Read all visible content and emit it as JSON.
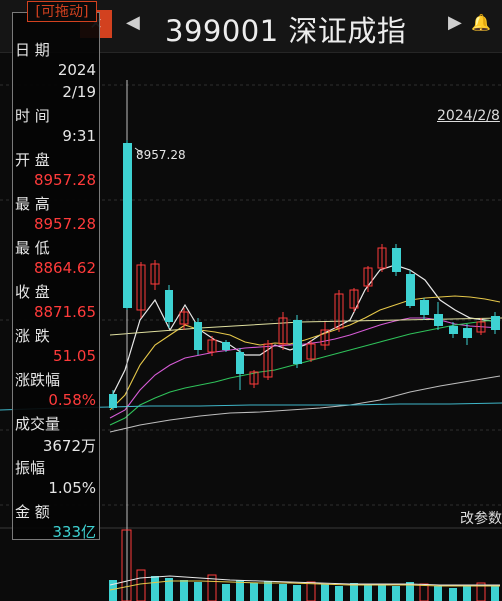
{
  "header": {
    "close_label": "✕",
    "title": "399001 深证成指"
  },
  "chart": {
    "date_label": "2024/2/8",
    "params_label": "改参数",
    "high_marker": "8957.28"
  },
  "panel": {
    "drag_label": "[可拖动]",
    "rows": [
      {
        "label": "日    期",
        "value": "2024"
      },
      {
        "label": "",
        "value": "2/19"
      },
      {
        "label": "时    间",
        "value": "9:31"
      },
      {
        "label": "开    盘",
        "value": "8957.28"
      },
      {
        "label": "最    高",
        "value": "8957.28"
      },
      {
        "label": "最    低",
        "value": "8864.62"
      },
      {
        "label": "收    盘",
        "value": "8871.65"
      },
      {
        "label": "涨    跌",
        "value": "51.05"
      },
      {
        "label": "涨跌幅",
        "value": "0.58%"
      },
      {
        "label": "成交量",
        "value": "3672万"
      },
      {
        "label": "振幅",
        "value": "1.05%"
      },
      {
        "label": "金    额",
        "value": "333亿"
      }
    ]
  },
  "colors": {
    "up": "#ff3b3b",
    "down": "#3ed2d2",
    "accent": "#d2411f"
  }
}
